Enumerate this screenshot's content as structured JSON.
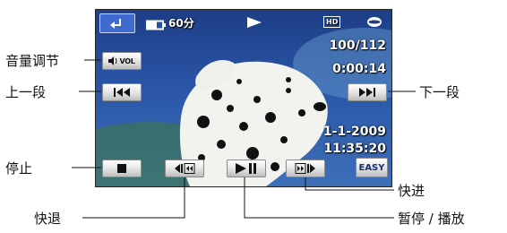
{
  "colors": {
    "screen_bg": "#2b56a8",
    "button_face": "#e6e6e6",
    "return_button": "#3f6bd0",
    "text": "#111111"
  },
  "screen": {
    "battery_time": "60分",
    "image_counter": "100/112",
    "elapsed_time": "0:00:14",
    "date": "1-1-2009",
    "time": "11:35:20",
    "quality_badge": "HD",
    "easy_label": "EASY",
    "vol_label": "VOL",
    "icons": [
      "return-icon",
      "battery-icon",
      "play-mode-icon",
      "hd-icon",
      "media-disc-icon"
    ]
  },
  "callouts": {
    "volume": "音量调节",
    "previous": "上一段",
    "stop": "停止",
    "rewind": "快退",
    "next": "下一段",
    "fast_forward": "快进",
    "pause_play": "暂停 / 播放"
  }
}
